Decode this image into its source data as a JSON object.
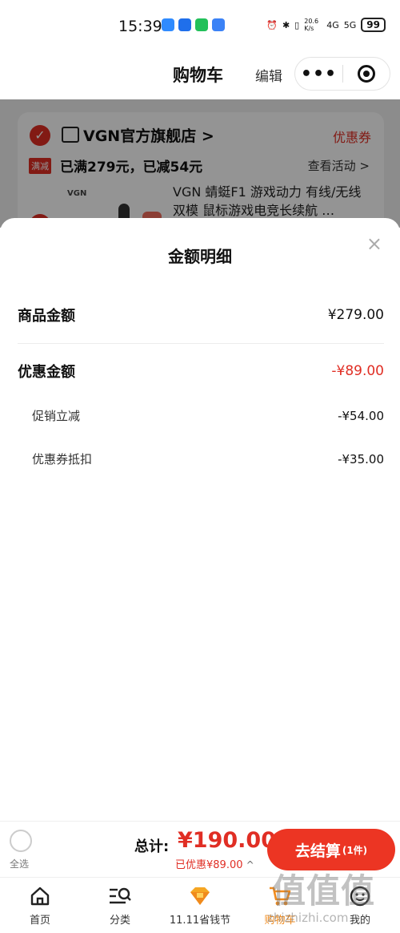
{
  "status_bar": {
    "time": "15:39",
    "net_speed": "20.6 K/s",
    "signal_1": "4G",
    "signal_2": "5G",
    "battery": "99"
  },
  "nav": {
    "title": "购物车",
    "edit": "编辑",
    "more_icon": "•••"
  },
  "cart": {
    "store_name": "VGN官方旗舰店 >",
    "coupon_link": "优惠券",
    "promo_tag": "满减",
    "promo_text": "已满279元，已减54元",
    "view_activity": "查看活动 >",
    "brand_mini": "VGN",
    "product_name": "VGN 蜻蜓F1 游戏动力 有线/无线双模 鼠标游戏电竞长续航 …"
  },
  "sheet": {
    "title": "金额明细",
    "close": "×",
    "rows": [
      {
        "label": "商品金额",
        "value": "¥279.00"
      },
      {
        "label": "优惠金额",
        "value": "-¥89.00"
      },
      {
        "label": "促销立减",
        "value": "-¥54.00"
      },
      {
        "label": "优惠券抵扣",
        "value": "-¥35.00"
      }
    ]
  },
  "checkout": {
    "select_all": "全选",
    "total_label": "总计:",
    "total_amount": "¥190.00",
    "discount_note": "已优惠¥89.00",
    "discount_caret": "^",
    "button_label": "去结算",
    "button_count": "(1件)"
  },
  "tabs": [
    {
      "label": "首页",
      "icon": "home-icon"
    },
    {
      "label": "分类",
      "icon": "category-search-icon"
    },
    {
      "label": "11.11省钱节",
      "icon": "diamond-icon"
    },
    {
      "label": "购物车",
      "icon": "cart-icon"
    },
    {
      "label": "我的",
      "icon": "profile-icon"
    }
  ],
  "watermark": {
    "text": "值值值",
    "url": "zhizhizhi.com"
  },
  "colors": {
    "accent_red": "#e02e24",
    "checkout_red": "#ec3523",
    "tab_active": "#f08a1c"
  }
}
